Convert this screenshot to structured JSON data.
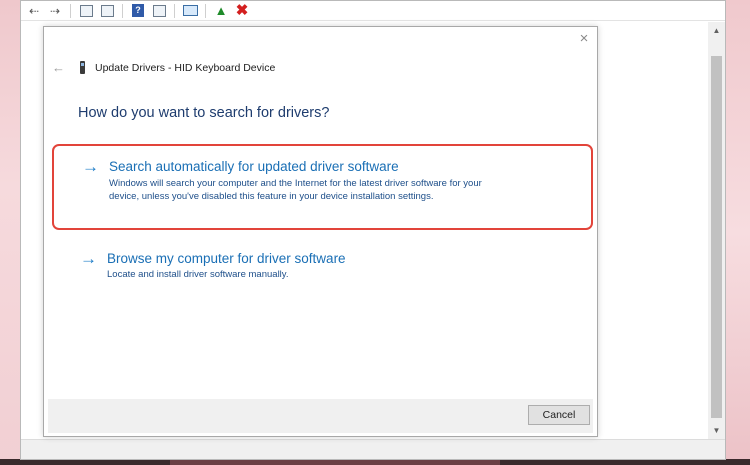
{
  "dialog": {
    "title": "Update Drivers - HID Keyboard Device",
    "question": "How do you want to search for drivers?",
    "options": [
      {
        "title": "Search automatically for updated driver software",
        "description": "Windows will search your computer and the Internet for the latest driver software for your device, unless you've disabled this feature in your device installation settings.",
        "highlighted": true
      },
      {
        "title": "Browse my computer for driver software",
        "description": "Locate and install driver software manually.",
        "highlighted": false
      }
    ],
    "cancel_label": "Cancel",
    "close_glyph": "×",
    "back_glyph": "←",
    "arrow_glyph": "→"
  },
  "toolbar": {
    "icons": [
      "back-icon",
      "forward-icon",
      "properties-icon",
      "show-hidden-icon",
      "help-icon",
      "view-icon",
      "monitor-icon",
      "update-driver-icon",
      "uninstall-icon"
    ]
  },
  "colors": {
    "highlight_border": "#e2443a",
    "link_blue": "#1a6fb5",
    "heading_blue": "#1e3c6e"
  }
}
